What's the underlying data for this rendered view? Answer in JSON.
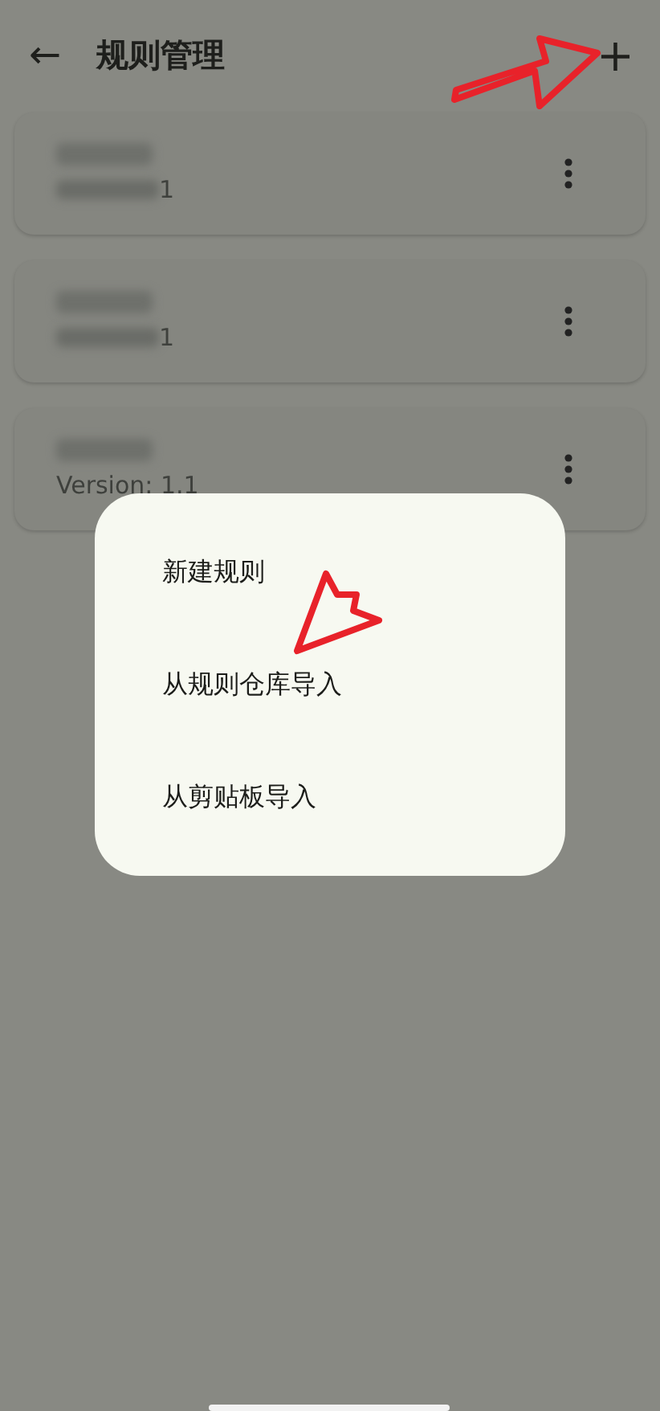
{
  "app_bar": {
    "back_icon": "←",
    "title": "规则管理",
    "add_icon": "+"
  },
  "rules": [
    {
      "title_redacted": true,
      "version": "1"
    },
    {
      "title_redacted": true,
      "version": "1"
    },
    {
      "title_redacted": true,
      "version": "Version: 1.1"
    }
  ],
  "menu": {
    "items": [
      "新建规则",
      "从规则仓库导入",
      "从剪贴板导入"
    ]
  }
}
